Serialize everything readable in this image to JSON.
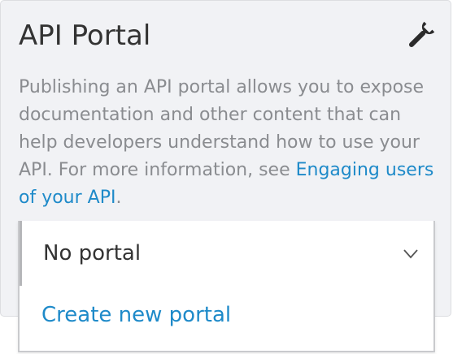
{
  "panel": {
    "title": "API Portal",
    "description_text": "Publishing an API portal allows you to expose documentation and other content that can help developers understand how to use your API. For more information, see ",
    "description_link": "Engaging users of your API",
    "description_end": ".",
    "settings_icon": "wrench-icon"
  },
  "portal_select": {
    "selected": "No portal",
    "chevron_icon": "chevron-down-icon",
    "options": [
      {
        "label": "Create new portal"
      }
    ]
  },
  "colors": {
    "link": "#1e8ac9",
    "panel_bg": "#f1f2f5",
    "text_primary": "#333333",
    "text_secondary": "#8a8c90"
  }
}
